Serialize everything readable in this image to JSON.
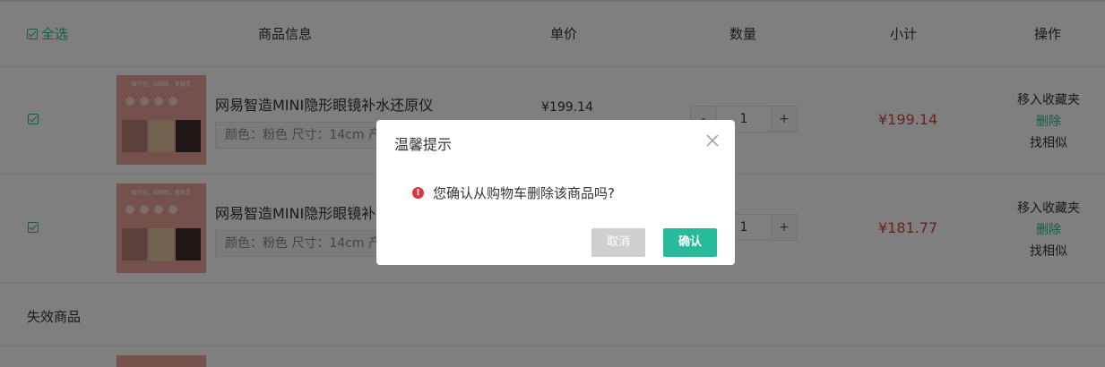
{
  "header": {
    "select_all": "全选",
    "product_info": "商品信息",
    "unit_price": "单价",
    "quantity": "数量",
    "subtotal": "小计",
    "operations": "操作"
  },
  "items": [
    {
      "name": "网易智造MINI隐形眼镜补水还原仪",
      "attrs": "颜色：粉色 尺寸：14cm 产",
      "image_caption": "敏于症，因彻底，更极灵",
      "price": "¥199.14",
      "quantity": "1",
      "subtotal": "¥199.14",
      "op_favorite": "移入收藏夹",
      "op_delete": "删除",
      "op_similar": "找相似",
      "checked": true
    },
    {
      "name": "网易智造MINI隐形眼镜补",
      "attrs": "颜色：粉色 尺寸：14cm 产",
      "image_caption": "敏于症，因彻底，更极灵",
      "price": "",
      "quantity": "1",
      "subtotal": "¥181.77",
      "op_favorite": "移入收藏夹",
      "op_delete": "删除",
      "op_similar": "找相似",
      "checked": true
    }
  ],
  "invalid_section": {
    "title": "失效商品"
  },
  "stepper": {
    "minus": "-",
    "plus": "+"
  },
  "dialog": {
    "title": "温馨提示",
    "message": "您确认从购物车删除该商品吗?",
    "warn_icon": "!",
    "cancel_label": "取消",
    "confirm_label": "确认"
  },
  "colors": {
    "accent": "#27ba9b",
    "price_red": "#cf4444",
    "warning_red": "#d9363e",
    "thumb_pink": "#e8a39b"
  }
}
